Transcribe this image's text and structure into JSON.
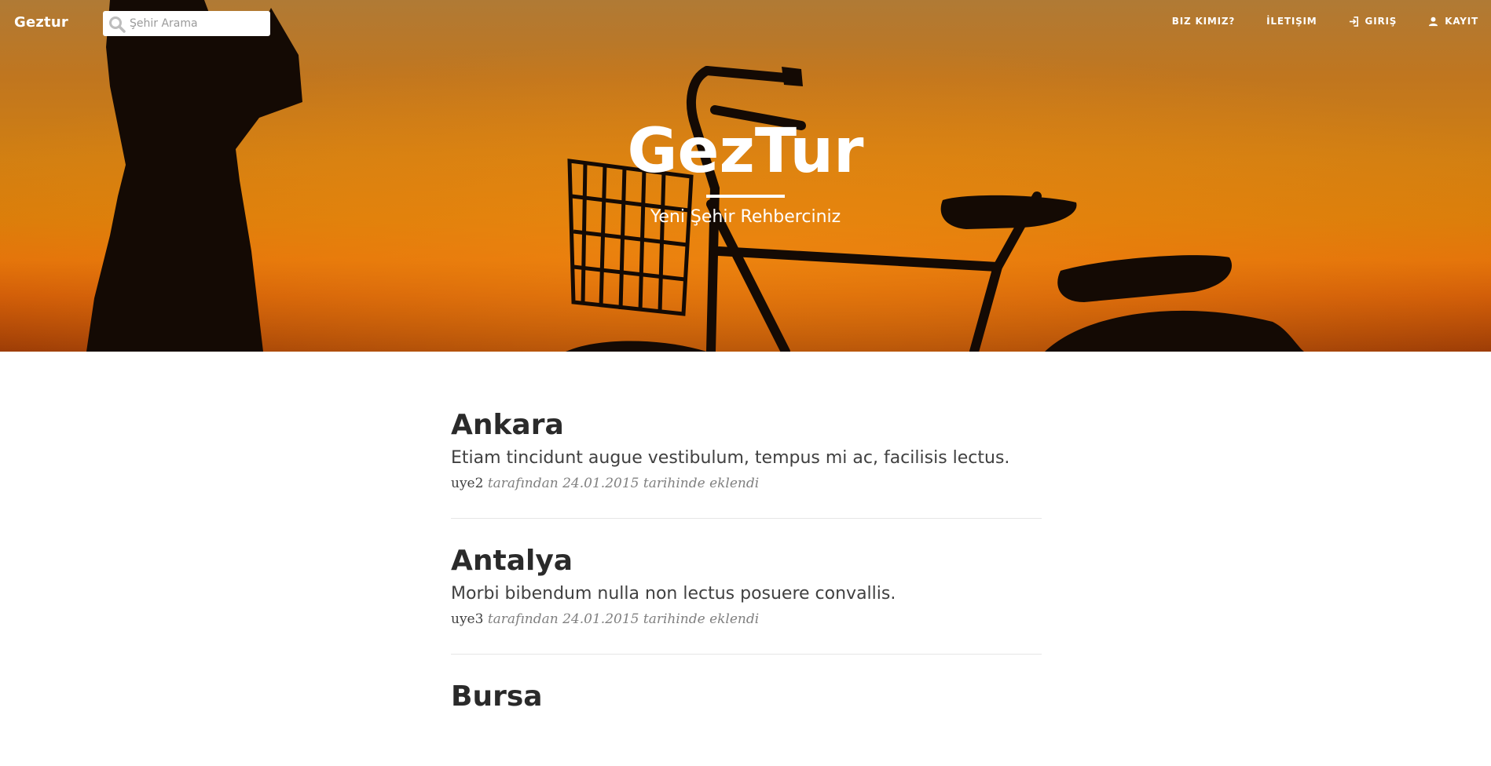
{
  "navbar": {
    "brand": "Geztur",
    "search_placeholder": "Şehir Arama",
    "items": [
      {
        "label": "BIZ KIMIZ?",
        "icon": ""
      },
      {
        "label": "İLETIŞIM",
        "icon": ""
      },
      {
        "label": "GIRIŞ",
        "icon": "login-icon"
      },
      {
        "label": "KAYIT",
        "icon": "user-icon"
      }
    ]
  },
  "hero": {
    "title": "GezTur",
    "subtitle": "Yeni Şehir Rehberciniz"
  },
  "posts": [
    {
      "title": "Ankara",
      "excerpt": "Etiam tincidunt augue vestibulum, tempus mi ac, facilisis lectus.",
      "author": "uye2",
      "meta": " tarafından 24.01.2015 tarihinde eklendi"
    },
    {
      "title": "Antalya",
      "excerpt": "Morbi bibendum nulla non lectus posuere convallis.",
      "author": "uye3",
      "meta": " tarafından 24.01.2015 tarihinde eklendi"
    },
    {
      "title": "Bursa",
      "excerpt": "",
      "author": "",
      "meta": ""
    }
  ],
  "colors": {
    "hero_orange": "#d97d0a",
    "text_dark": "#2a2a2a",
    "meta_gray": "#808080"
  }
}
